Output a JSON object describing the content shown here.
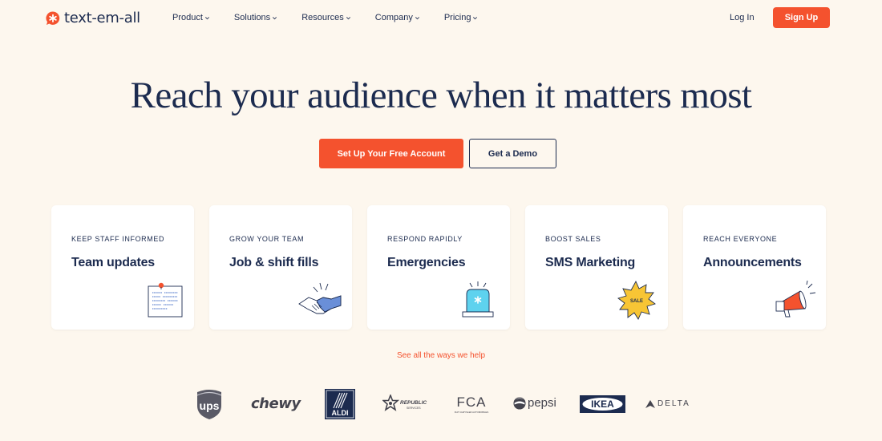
{
  "brand": {
    "name": "text-em-all",
    "accent": "#f4522e",
    "navy": "#1c2b4f",
    "background": "#fdf7ee"
  },
  "nav": {
    "items": [
      {
        "label": "Product",
        "icon": "chevron-down-icon"
      },
      {
        "label": "Solutions",
        "icon": "chevron-down-icon"
      },
      {
        "label": "Resources",
        "icon": "chevron-down-icon"
      },
      {
        "label": "Company",
        "icon": "chevron-down-icon"
      },
      {
        "label": "Pricing",
        "icon": "chevron-down-icon"
      }
    ],
    "login_label": "Log In",
    "signup_label": "Sign Up"
  },
  "hero": {
    "title": "Reach your audience when it matters most",
    "primary_cta": "Set Up Your Free Account",
    "secondary_cta": "Get a Demo"
  },
  "use_cases": [
    {
      "eyebrow": "KEEP STAFF INFORMED",
      "title": "Team updates",
      "icon": "bulletin-note-icon"
    },
    {
      "eyebrow": "GROW YOUR TEAM",
      "title": "Job & shift fills",
      "icon": "handshake-icon"
    },
    {
      "eyebrow": "RESPOND RAPIDLY",
      "title": "Emergencies",
      "icon": "siren-icon"
    },
    {
      "eyebrow": "BOOST SALES",
      "title": "SMS Marketing",
      "icon": "sale-badge-icon",
      "badge_text": "SALE"
    },
    {
      "eyebrow": "REACH EVERYONE",
      "title": "Announcements",
      "icon": "megaphone-icon"
    }
  ],
  "see_all_label": "See all the ways we help",
  "customer_logos": [
    {
      "name": "ups",
      "label": "ups"
    },
    {
      "name": "chewy",
      "label": "chewy"
    },
    {
      "name": "aldi",
      "label": "ALDI"
    },
    {
      "name": "republic-services",
      "label": "REPUBLIC",
      "sublabel": "SERVICES"
    },
    {
      "name": "fca",
      "label": "FCA",
      "sublabel": "FIAT CHRYSLER AUTOMOBILES"
    },
    {
      "name": "pepsi",
      "label": "pepsi"
    },
    {
      "name": "ikea",
      "label": "IKEA"
    },
    {
      "name": "delta",
      "label": "DELTA"
    }
  ]
}
